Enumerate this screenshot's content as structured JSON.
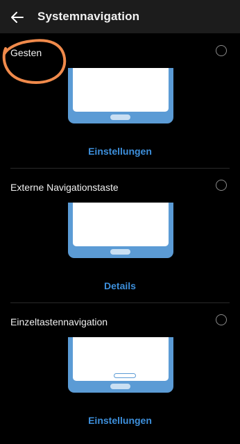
{
  "header": {
    "title": "Systemnavigation",
    "back_icon": "arrow-left-icon"
  },
  "options": [
    {
      "label": "Gesten",
      "link": "Einstellungen",
      "selected": false
    },
    {
      "label": "Externe Navigationstaste",
      "link": "Details",
      "selected": false
    },
    {
      "label": "Einzeltastennavigation",
      "link": "Einstellungen",
      "selected": false
    }
  ],
  "colors": {
    "accent": "#3d8fdb",
    "phone_frame": "#5b9bd5",
    "annotation": "#f08a4b",
    "background": "#000000",
    "header_bg": "#1c1c1c"
  }
}
